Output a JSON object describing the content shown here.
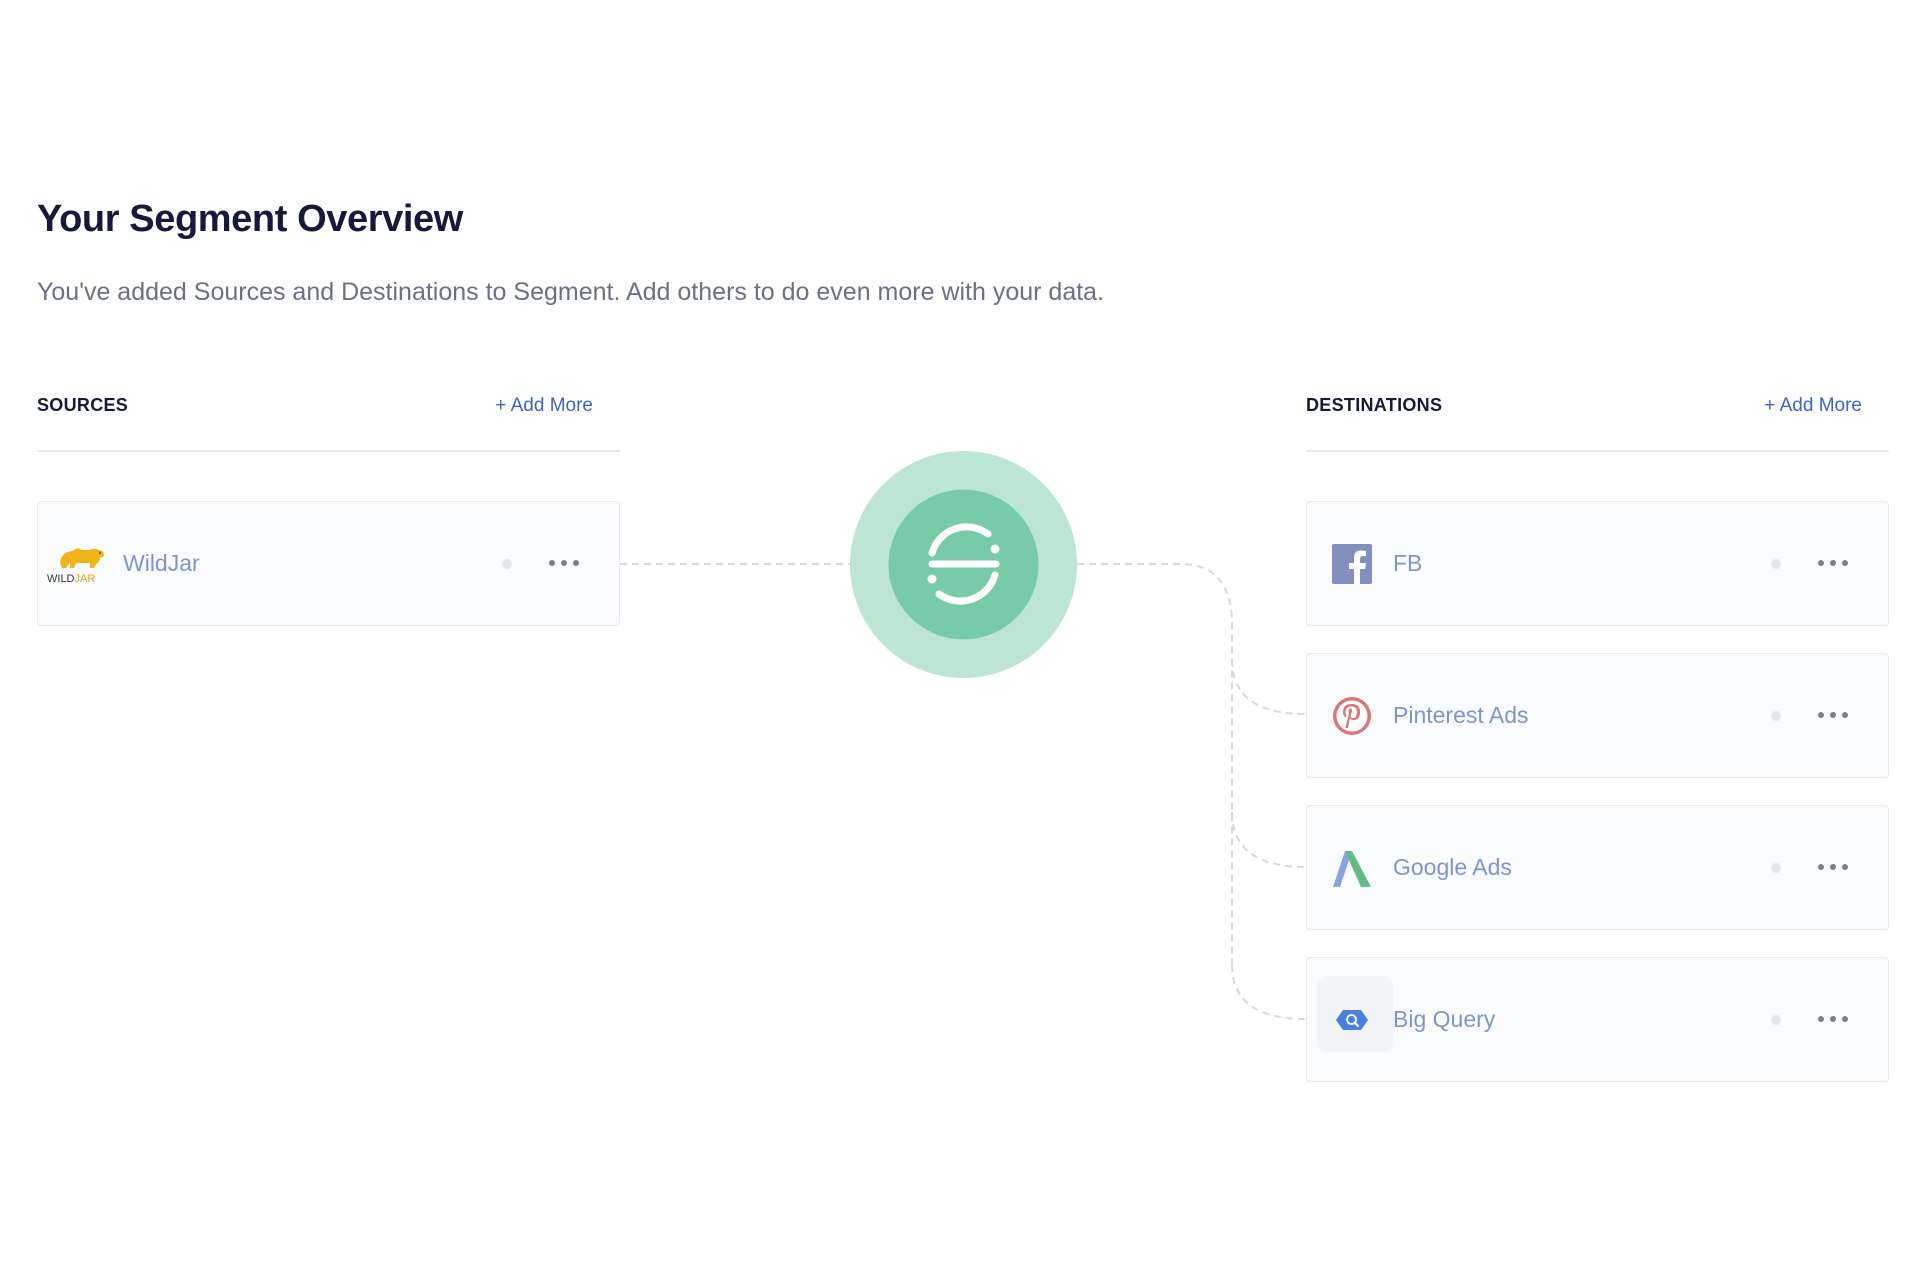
{
  "page": {
    "title": "Your Segment Overview",
    "subtitle": "You've added Sources and Destinations to Segment. Add others to do even more with your data."
  },
  "sources": {
    "label": "SOURCES",
    "add_more": "+ Add More",
    "items": [
      {
        "name": "WildJar",
        "logo_text_a": "WILD",
        "logo_text_b": "JAR",
        "icon": "wildjar-bear-logo"
      }
    ]
  },
  "destinations": {
    "label": "DESTINATIONS",
    "add_more": "+ Add More",
    "items": [
      {
        "name": "FB",
        "icon": "facebook-icon"
      },
      {
        "name": "Pinterest Ads",
        "icon": "pinterest-icon"
      },
      {
        "name": "Google Ads",
        "icon": "google-ads-icon"
      },
      {
        "name": "Big Query",
        "icon": "bigquery-icon"
      }
    ]
  },
  "colors": {
    "accent_link": "#3f63c7",
    "item_label": "#7d95cf",
    "hub_outer": "#bce5d3",
    "hub_inner": "#78cba7",
    "facebook": "#8390bf",
    "pinterest": "#d77777",
    "wildjar": "#f0b418",
    "bigquery": "#4a7fe0"
  }
}
